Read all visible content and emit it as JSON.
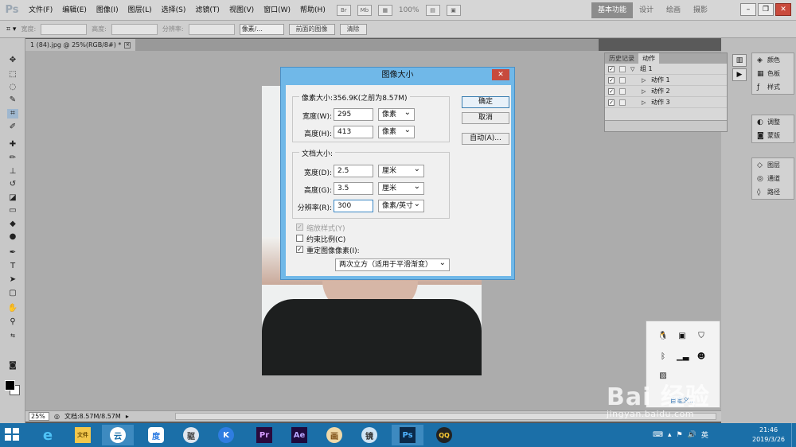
{
  "app": {
    "logo": "Ps"
  },
  "menubar": {
    "items": [
      "文件(F)",
      "编辑(E)",
      "图像(I)",
      "图层(L)",
      "选择(S)",
      "滤镜(T)",
      "视图(V)",
      "窗口(W)",
      "帮助(H)"
    ],
    "tool_br": "Br",
    "tool_mb": "Mb",
    "zoom": "100%",
    "workspaces": [
      "基本功能",
      "设计",
      "绘画",
      "摄影"
    ]
  },
  "options": {
    "width_label": "宽度:",
    "height_label": "高度:",
    "resolution_label": "分辨率:",
    "unit": "像素/...",
    "front_image": "前面的图像",
    "clear": "清除"
  },
  "document": {
    "tab": "1 (84).jpg @ 25%(RGB/8#) *"
  },
  "status": {
    "zoom": "25%",
    "doc": "文档:8.57M/8.57M"
  },
  "panels": {
    "history_tab": "历史记录",
    "actions_tab": "动作",
    "actions": [
      {
        "name": "组 1",
        "group": true
      },
      {
        "name": "动作 1",
        "group": false
      },
      {
        "name": "动作 2",
        "group": false
      },
      {
        "name": "动作 3",
        "group": false
      }
    ],
    "group1": [
      "颜色",
      "色板",
      "样式"
    ],
    "group2": [
      "调整",
      "蒙版"
    ],
    "group3": [
      "图层",
      "通道",
      "路径"
    ]
  },
  "dialog": {
    "title": "图像大小",
    "pixel_legend": "像素大小:356.9K(之前为8.57M)",
    "pixel_width_label": "宽度(W):",
    "pixel_width": "295",
    "pixel_width_unit": "像素",
    "pixel_height_label": "高度(H):",
    "pixel_height": "413",
    "pixel_height_unit": "像素",
    "doc_legend": "文档大小:",
    "doc_width_label": "宽度(D):",
    "doc_width": "2.5",
    "doc_width_unit": "厘米",
    "doc_height_label": "高度(G):",
    "doc_height": "3.5",
    "doc_height_unit": "厘米",
    "resolution_label": "分辨率(R):",
    "resolution": "300",
    "resolution_unit": "像素/英寸",
    "scale_styles": "缩放样式(Y)",
    "constrain": "约束比例(C)",
    "resample": "重定图像像素(I):",
    "resample_method": "两次立方（适用于平滑渐变）",
    "ok": "确定",
    "cancel": "取消",
    "auto": "自动(A)..."
  },
  "tray_popup": {
    "link": "自定义..."
  },
  "watermark": {
    "main": "Bai 经验",
    "sub": "jingyan.baidu.com"
  },
  "taskbar": {
    "apps": [
      "e",
      "文件",
      "云",
      "度",
      "驱",
      "K",
      "Pr",
      "Ae",
      "画",
      "镜",
      "Ps",
      "QQ"
    ],
    "lang": "英",
    "time": "21:46",
    "date": "2019/3/26"
  }
}
